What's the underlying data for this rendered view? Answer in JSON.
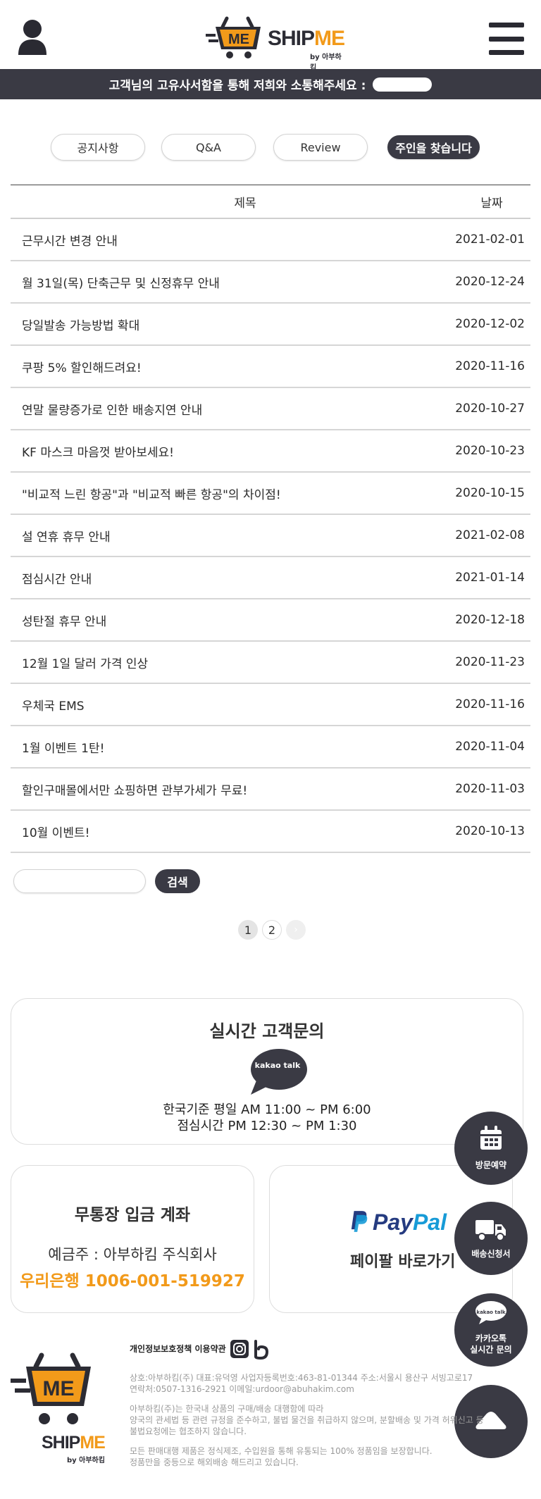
{
  "header": {
    "logo_me": "ME",
    "logo_ship": "SHIP",
    "logo_me2": "ME",
    "logo_by": "by 아부하킴",
    "notice": "고객님의 고유사서함을 통해 저희와 소통해주세요 :"
  },
  "tabs": [
    {
      "label": "공지사항"
    },
    {
      "label": "Q&A"
    },
    {
      "label": "Review"
    },
    {
      "label": "주인을 찾습니다"
    }
  ],
  "table": {
    "col_title": "제목",
    "col_date": "날짜",
    "rows": [
      {
        "title": "근무시간 변경 안내",
        "date": "2021-02-01"
      },
      {
        "title": "월 31일(목) 단축근무 및 신정휴무 안내",
        "date": "2020-12-24"
      },
      {
        "title": "당일발송 가능방법 확대",
        "date": "2020-12-02"
      },
      {
        "title": "쿠팡 5% 할인해드려요!",
        "date": "2020-11-16"
      },
      {
        "title": "연말 물량증가로 인한 배송지연 안내",
        "date": "2020-10-27"
      },
      {
        "title": "KF 마스크 마음껏 받아보세요!",
        "date": "2020-10-23"
      },
      {
        "title": "\"비교적 느린 항공\"과 \"비교적 빠른 항공\"의 차이점!",
        "date": "2020-10-15"
      },
      {
        "title": "설 연휴 휴무 안내",
        "date": "2021-02-08"
      },
      {
        "title": "점심시간 안내",
        "date": "2021-01-14"
      },
      {
        "title": "성탄절 휴무 안내",
        "date": "2020-12-18"
      },
      {
        "title": "12월 1일 달러 가격 인상",
        "date": "2020-11-23"
      },
      {
        "title": "우체국 EMS",
        "date": "2020-11-16"
      },
      {
        "title": "1월 이벤트 1탄!",
        "date": "2020-11-04"
      },
      {
        "title": "할인구매몰에서만 쇼핑하면 관부가세가 무료!",
        "date": "2020-11-03"
      },
      {
        "title": "10월 이벤트!",
        "date": "2020-10-13"
      }
    ]
  },
  "search": {
    "button": "검색",
    "value": ""
  },
  "pagination": {
    "pages": [
      "1",
      "2"
    ],
    "current": "1",
    "next": "›"
  },
  "realtime": {
    "title": "실시간 고객문의",
    "bubble": "kakao talk",
    "hours_1": "한국기준 평일 AM 11:00 ~ PM 6:00",
    "hours_2": "점심시간 PM 12:30 ~ PM 1:30"
  },
  "bank": {
    "title": "무통장 입금 계좌",
    "holder": "예금주 : 아부하킴 주식회사",
    "account": "우리은행 1006-001-519927"
  },
  "paypal": {
    "logo_pay": "Pay",
    "logo_pal": "Pal",
    "link": "페이팔 바로가기"
  },
  "fabs": {
    "visit": "방문예약",
    "shipping": "배송신청서",
    "kakao_bubble": "kakao talk",
    "kakao_1": "카카오톡",
    "kakao_2": "실시간 문의"
  },
  "footer": {
    "logo_me": "ME",
    "logo_ship": "SHIP",
    "logo_me2": "ME",
    "logo_by": "by 아부하킴",
    "links": "개인정보보호정책 이용약관",
    "line1": "상호:아부하킴(주)      대표:유덕영      사업자등록번호:463-81-01344      주소:서울시 용산구 서빙고로17",
    "line2": "연락처:0507-1316-2921      이메일:urdoor@abuhakim.com",
    "line3": "아부하킴(주)는 한국내 상품의 구매/배송 대행함에 따라",
    "line4": "양국의 관세법 등 관련 규정을 준수하고, 불법 물건을 취급하지 않으며, 분할배송 및 가격 허위신고 등",
    "line5": "불법요청에는 협조하지 않습니다.",
    "line6": "모든 판매대행 제품은 정식제조, 수입원을 통해 유통되는 100% 정품임을 보장합니다.",
    "line7": "정품만을 중등으로 해외배송 해드리고 있습니다."
  },
  "colors": {
    "dark": "#3a3a44",
    "accent": "#f29a1a",
    "paypal_blue": "#253b80",
    "paypal_light": "#179bd7"
  }
}
